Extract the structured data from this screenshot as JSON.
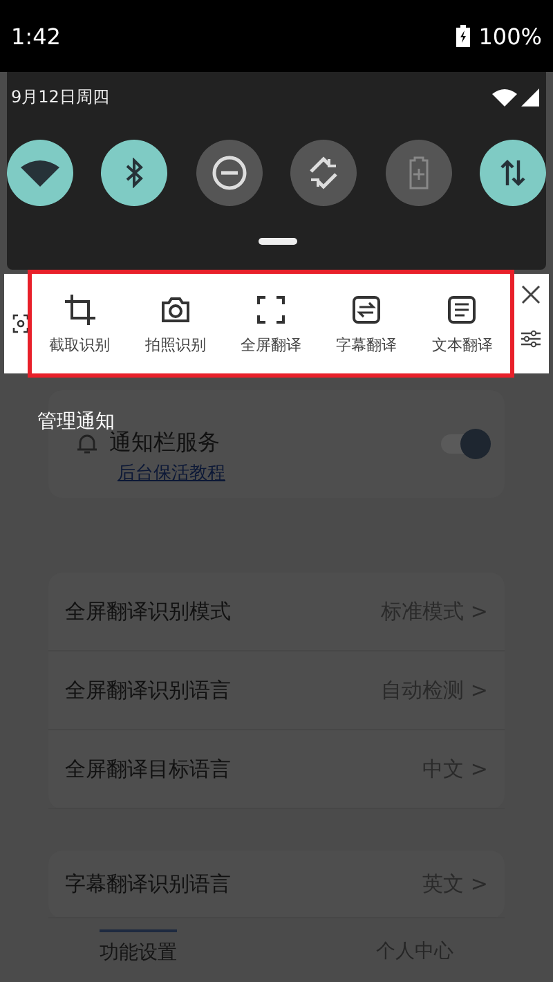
{
  "status_bar": {
    "time": "1:42",
    "battery": "100%"
  },
  "shade": {
    "date": "9月12日周四",
    "toggles": [
      {
        "kind": "wifi",
        "on": true
      },
      {
        "kind": "bluetooth",
        "on": true
      },
      {
        "kind": "dnd",
        "on": false
      },
      {
        "kind": "rotate",
        "on": false
      },
      {
        "kind": "battery",
        "on": false
      },
      {
        "kind": "data",
        "on": true
      }
    ]
  },
  "toolbar": {
    "items": [
      {
        "kind": "crop",
        "label": "截取识别"
      },
      {
        "kind": "camera",
        "label": "拍照识别"
      },
      {
        "kind": "fullscreen",
        "label": "全屏翻译"
      },
      {
        "kind": "subtitle",
        "label": "字幕翻译"
      },
      {
        "kind": "text",
        "label": "文本翻译"
      }
    ]
  },
  "manage_label": "管理通知",
  "service": {
    "title": "通知栏服务",
    "link": "后台保活教程",
    "on": true
  },
  "settings": [
    {
      "label": "全屏翻译识别模式",
      "value": "标准模式 >"
    },
    {
      "label": "全屏翻译识别语言",
      "value": "自动检测 >"
    },
    {
      "label": "全屏翻译目标语言",
      "value": "中文 >"
    }
  ],
  "subtitle_settings": [
    {
      "label": "字幕翻译识别语言",
      "value": "英文 >"
    }
  ],
  "nav": [
    {
      "label": "功能设置",
      "selected": true
    },
    {
      "label": "个人中心",
      "selected": false
    }
  ]
}
